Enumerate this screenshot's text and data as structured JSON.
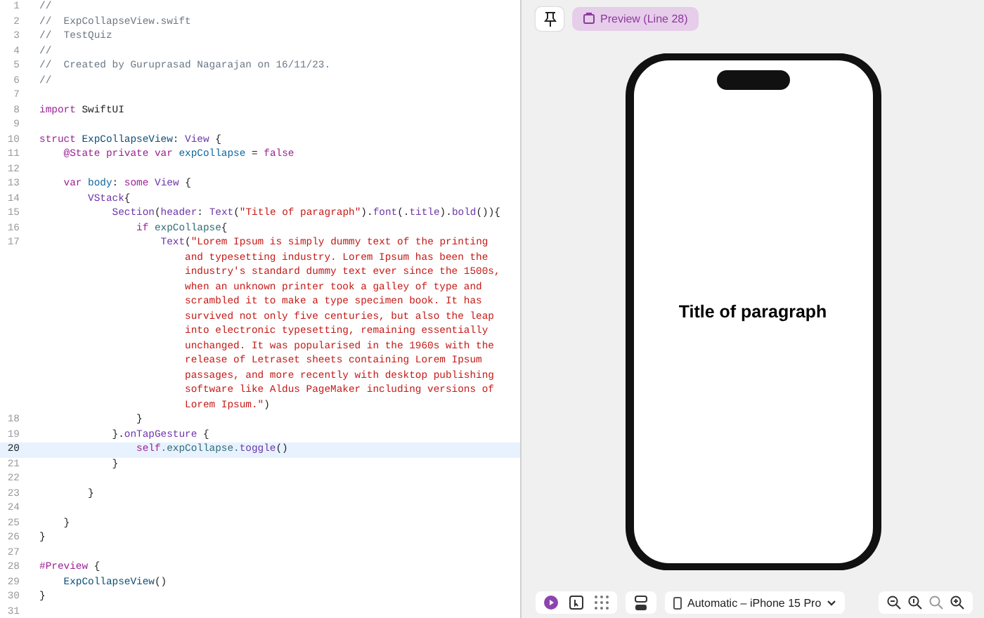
{
  "editor": {
    "lines": [
      {
        "number": "1",
        "current": false,
        "segments": [
          {
            "kind": "comment",
            "text": "//"
          }
        ]
      },
      {
        "number": "2",
        "current": false,
        "segments": [
          {
            "kind": "comment",
            "text": "//  ExpCollapseView.swift"
          }
        ]
      },
      {
        "number": "3",
        "current": false,
        "segments": [
          {
            "kind": "comment",
            "text": "//  TestQuiz"
          }
        ]
      },
      {
        "number": "4",
        "current": false,
        "segments": [
          {
            "kind": "comment",
            "text": "//"
          }
        ]
      },
      {
        "number": "5",
        "current": false,
        "segments": [
          {
            "kind": "comment",
            "text": "//  Created by Guruprasad Nagarajan on 16/11/23."
          }
        ]
      },
      {
        "number": "6",
        "current": false,
        "segments": [
          {
            "kind": "comment",
            "text": "//"
          }
        ]
      },
      {
        "number": "7",
        "current": false
      },
      {
        "number": "8",
        "current": false,
        "segments": [
          {
            "kind": "keyword",
            "text": "import"
          },
          {
            "kind": "plain",
            "text": " SwiftUI"
          }
        ]
      },
      {
        "number": "9",
        "current": false
      },
      {
        "number": "10",
        "current": false,
        "segments": [
          {
            "kind": "keyword",
            "text": "struct "
          },
          {
            "kind": "type_decl",
            "text": "ExpCollapseView"
          },
          {
            "kind": "plain",
            "text": ": "
          },
          {
            "kind": "type",
            "text": "View"
          },
          {
            "kind": "plain",
            "text": " {"
          }
        ]
      },
      {
        "number": "11",
        "current": false,
        "segments": [
          {
            "kind": "keyword",
            "text": "    @State private var "
          },
          {
            "kind": "ident_decl",
            "text": "expCollapse"
          },
          {
            "kind": "plain",
            "text": " = "
          },
          {
            "kind": "keyword",
            "text": "false"
          }
        ]
      },
      {
        "number": "12",
        "current": false
      },
      {
        "number": "13",
        "current": false,
        "segments": [
          {
            "kind": "keyword",
            "text": "    var "
          },
          {
            "kind": "ident_decl",
            "text": "body"
          },
          {
            "kind": "plain",
            "text": ": "
          },
          {
            "kind": "keyword",
            "text": "some "
          },
          {
            "kind": "type",
            "text": "View"
          },
          {
            "kind": "plain",
            "text": " {"
          }
        ]
      },
      {
        "number": "14",
        "current": false,
        "segments": [
          {
            "kind": "type",
            "text": "        VStack"
          },
          {
            "kind": "plain",
            "text": "{"
          }
        ]
      },
      {
        "number": "15",
        "current": false,
        "segments": [
          {
            "kind": "type",
            "text": "            Section"
          },
          {
            "kind": "plain",
            "text": "("
          },
          {
            "kind": "type",
            "text": "header"
          },
          {
            "kind": "plain",
            "text": ": "
          },
          {
            "kind": "type",
            "text": "Text"
          },
          {
            "kind": "plain",
            "text": "("
          },
          {
            "kind": "string",
            "text": "\"Title of paragraph\""
          },
          {
            "kind": "plain",
            "text": ")."
          },
          {
            "kind": "func",
            "text": "font"
          },
          {
            "kind": "plain",
            "text": "(."
          },
          {
            "kind": "func",
            "text": "title"
          },
          {
            "kind": "plain",
            "text": ")."
          },
          {
            "kind": "func",
            "text": "bold"
          },
          {
            "kind": "plain",
            "text": "()){"
          }
        ]
      },
      {
        "number": "16",
        "current": false,
        "segments": [
          {
            "kind": "keyword",
            "text": "                if "
          },
          {
            "kind": "ident",
            "text": "expCollapse"
          },
          {
            "kind": "plain",
            "text": "{"
          }
        ]
      },
      {
        "number": "17",
        "current": false,
        "segments": [
          {
            "kind": "type",
            "text": "                    Text"
          },
          {
            "kind": "plain",
            "text": "("
          },
          {
            "kind": "string",
            "text": "\"Lorem Ipsum is simply dummy text of the printing"
          }
        ],
        "continuation": [
          [
            {
              "kind": "string",
              "text": "and typesetting industry. Lorem Ipsum has been the"
            }
          ],
          [
            {
              "kind": "string",
              "text": "industry's standard dummy text ever since the 1500s,"
            }
          ],
          [
            {
              "kind": "string",
              "text": "when an unknown printer took a galley of type and"
            }
          ],
          [
            {
              "kind": "string",
              "text": "scrambled it to make a type specimen book. It has"
            }
          ],
          [
            {
              "kind": "string",
              "text": "survived not only five centuries, but also the leap"
            }
          ],
          [
            {
              "kind": "string",
              "text": "into electronic typesetting, remaining essentially"
            }
          ],
          [
            {
              "kind": "string",
              "text": "unchanged. It was popularised in the 1960s with the"
            }
          ],
          [
            {
              "kind": "string",
              "text": "release of Letraset sheets containing Lorem Ipsum"
            }
          ],
          [
            {
              "kind": "string",
              "text": "passages, and more recently with desktop publishing"
            }
          ],
          [
            {
              "kind": "string",
              "text": "software like Aldus PageMaker including versions of"
            }
          ],
          [
            {
              "kind": "string",
              "text": "Lorem Ipsum.\""
            },
            {
              "kind": "plain",
              "text": ")"
            }
          ]
        ]
      },
      {
        "number": "18",
        "current": false,
        "segments": [
          {
            "kind": "plain",
            "text": "                }"
          }
        ]
      },
      {
        "number": "19",
        "current": false,
        "segments": [
          {
            "kind": "plain",
            "text": "            }."
          },
          {
            "kind": "func",
            "text": "onTapGesture"
          },
          {
            "kind": "plain",
            "text": " {"
          }
        ]
      },
      {
        "number": "20",
        "current": true,
        "segments": [
          {
            "kind": "keyword",
            "text": "                self"
          },
          {
            "kind": "ident",
            "text": ".expCollapse."
          },
          {
            "kind": "func",
            "text": "toggle"
          },
          {
            "kind": "plain",
            "text": "()"
          }
        ]
      },
      {
        "number": "21",
        "current": false,
        "segments": [
          {
            "kind": "plain",
            "text": "            }"
          }
        ]
      },
      {
        "number": "22",
        "current": false
      },
      {
        "number": "23",
        "current": false,
        "segments": [
          {
            "kind": "plain",
            "text": "        }"
          }
        ]
      },
      {
        "number": "24",
        "current": false
      },
      {
        "number": "25",
        "current": false,
        "segments": [
          {
            "kind": "plain",
            "text": "    }"
          }
        ]
      },
      {
        "number": "26",
        "current": false,
        "segments": [
          {
            "kind": "plain",
            "text": "}"
          }
        ]
      },
      {
        "number": "27",
        "current": false
      },
      {
        "number": "28",
        "current": false,
        "segments": [
          {
            "kind": "keyword",
            "text": "#Preview"
          },
          {
            "kind": "plain",
            "text": " {"
          }
        ]
      },
      {
        "number": "29",
        "current": false,
        "segments": [
          {
            "kind": "type_decl",
            "text": "    ExpCollapseView"
          },
          {
            "kind": "plain",
            "text": "()"
          }
        ]
      },
      {
        "number": "30",
        "current": false,
        "segments": [
          {
            "kind": "plain",
            "text": "}"
          }
        ]
      },
      {
        "number": "31",
        "current": false
      }
    ]
  },
  "preview": {
    "tab": {
      "label": "Preview (Line 28)",
      "selected": true
    },
    "canvas": {
      "title": "Title of paragraph"
    },
    "bottom_bar": {
      "modes": [
        {
          "kind": "live",
          "selected": true
        },
        {
          "kind": "select",
          "selected": false
        },
        {
          "kind": "variants",
          "selected": false
        }
      ],
      "device": "Automatic – iPhone 15 Pro"
    }
  }
}
